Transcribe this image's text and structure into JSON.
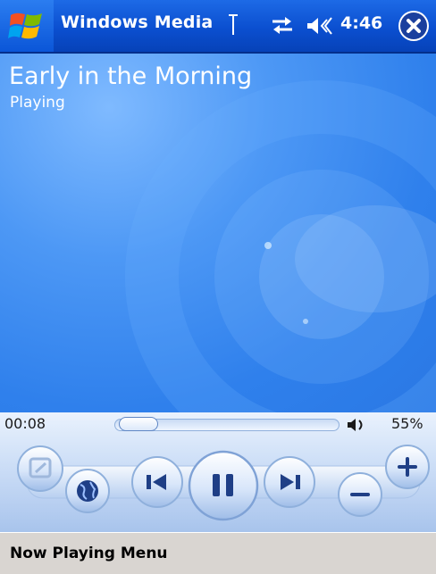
{
  "titlebar": {
    "app_title": "Windows Media",
    "clock": "4:46",
    "icons": [
      "windows-flag-icon",
      "signal-strength-icon",
      "connectivity-icon",
      "speaker-volume-icon",
      "close-icon"
    ]
  },
  "now_playing": {
    "track_title": "Early in the Morning",
    "status": "Playing"
  },
  "seek": {
    "elapsed": "00:08",
    "position_fraction": 0.02
  },
  "volume": {
    "percent_text": "55%",
    "level": 0.55
  },
  "controls": [
    "visualization-button",
    "web-globe-button",
    "previous-track-button",
    "pause-button",
    "next-track-button",
    "volume-down-button",
    "volume-up-button"
  ],
  "menubar": {
    "left_label": "Now Playing",
    "right_label": "Menu"
  },
  "colors": {
    "titlebar_blue": "#0b4fd0",
    "nowplaying_blue": "#2f80ec",
    "menubar_gray": "#d9d5d1"
  }
}
